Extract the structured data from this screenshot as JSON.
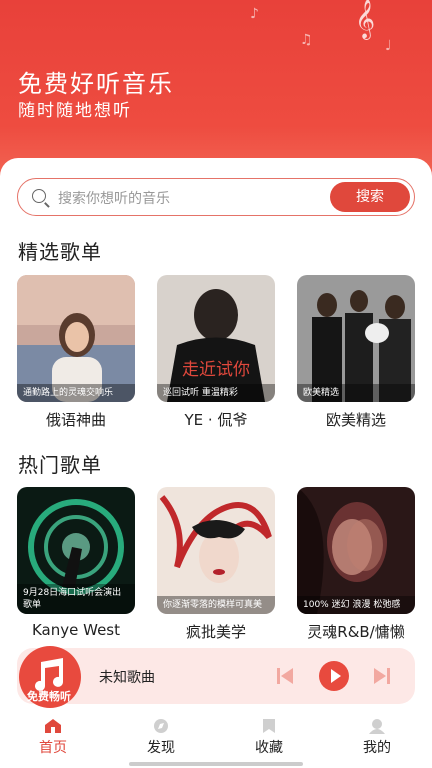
{
  "hero": {
    "title": "免费好听音乐",
    "subtitle": "随时随地想听"
  },
  "search": {
    "placeholder": "搜索你想听的音乐",
    "button": "搜索"
  },
  "featured": {
    "title": "精选歌单",
    "items": [
      {
        "caption": "通勤路上的灵魂交响乐",
        "name": "俄语神曲"
      },
      {
        "caption": "巡回试听 重温精彩",
        "name": "YE · 侃爷"
      },
      {
        "caption": "欧美精选",
        "name": "欧美精选"
      }
    ]
  },
  "hot": {
    "title": "热门歌单",
    "items": [
      {
        "caption": "9月28日海口试听会演出歌单",
        "name": "Kanye West"
      },
      {
        "caption": "你逐渐零落的模样可真美",
        "name": "疯批美学"
      },
      {
        "caption": "100% 迷幻 浪漫 松弛感",
        "name": "灵魂R&B/慵懒"
      }
    ]
  },
  "player": {
    "disc_label": "免费畅听",
    "song": "未知歌曲"
  },
  "tabs": [
    {
      "label": "首页",
      "icon": "home-icon",
      "active": true
    },
    {
      "label": "发现",
      "icon": "discover-icon"
    },
    {
      "label": "收藏",
      "icon": "bookmark-icon"
    },
    {
      "label": "我的",
      "icon": "profile-icon"
    }
  ],
  "colors": {
    "accent": "#e0483c",
    "player_bg": "#fde8e6"
  }
}
